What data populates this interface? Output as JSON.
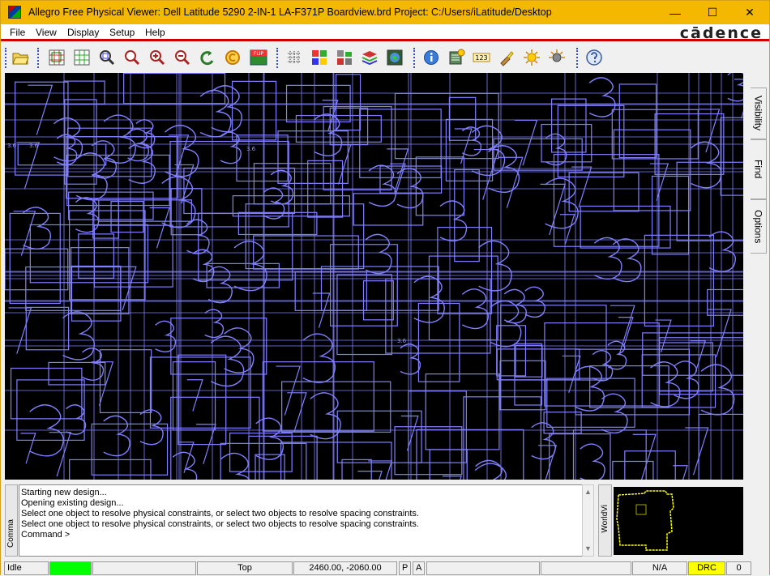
{
  "window": {
    "title": "Allegro Free Physical Viewer: Dell Latitude 5290 2-IN-1 LA-F371P Boardview.brd  Project: C:/Users/iLatitude/Desktop",
    "controls": {
      "minimize": "—",
      "maximize": "☐",
      "close": "✕"
    }
  },
  "menu": {
    "items": [
      {
        "label": "File"
      },
      {
        "label": "View"
      },
      {
        "label": "Display"
      },
      {
        "label": "Setup"
      },
      {
        "label": "Help"
      }
    ],
    "brand": "cādence"
  },
  "toolbar": {
    "buttons": [
      "open-icon",
      "zoom-fit-icon",
      "zoom-grid-icon",
      "zoom-window-icon",
      "zoom-area-icon",
      "zoom-in-icon",
      "zoom-out-icon",
      "zoom-previous-icon",
      "redraw-icon",
      "flip-icon",
      "grid-icon",
      "color-icon",
      "layers-icon",
      "stack-icon",
      "world-icon",
      "info-icon",
      "measure-icon",
      "number-icon",
      "highlight-icon",
      "sun-icon",
      "dehighlight-icon",
      "help-icon"
    ],
    "flip_label": "FLIP",
    "number_label": "123"
  },
  "side_tabs": [
    {
      "label": "Visibility"
    },
    {
      "label": "Find"
    },
    {
      "label": "Options"
    }
  ],
  "canvas": {
    "labels": [
      "3.6",
      "3.6",
      "3.6",
      "3.6"
    ],
    "trace_color": "#8080ff"
  },
  "command": {
    "handle_label": "Comma",
    "lines": [
      "Starting new design...",
      "Opening existing design...",
      "Select one object to resolve physical constraints, or select two objects to resolve spacing constraints.",
      "Select one object to resolve physical constraints, or select two objects to resolve spacing constraints.",
      "Command >"
    ]
  },
  "worldview": {
    "handle_label": "WorldVi"
  },
  "status": {
    "state": "Idle",
    "layer": "Top",
    "coords": "2460.00, -2060.00",
    "p_flag": "P",
    "a_flag": "A",
    "na": "N/A",
    "drc": "DRC",
    "drc_count": "0",
    "colors": {
      "busy": "#00ff00",
      "drc": "#ffff00"
    }
  }
}
